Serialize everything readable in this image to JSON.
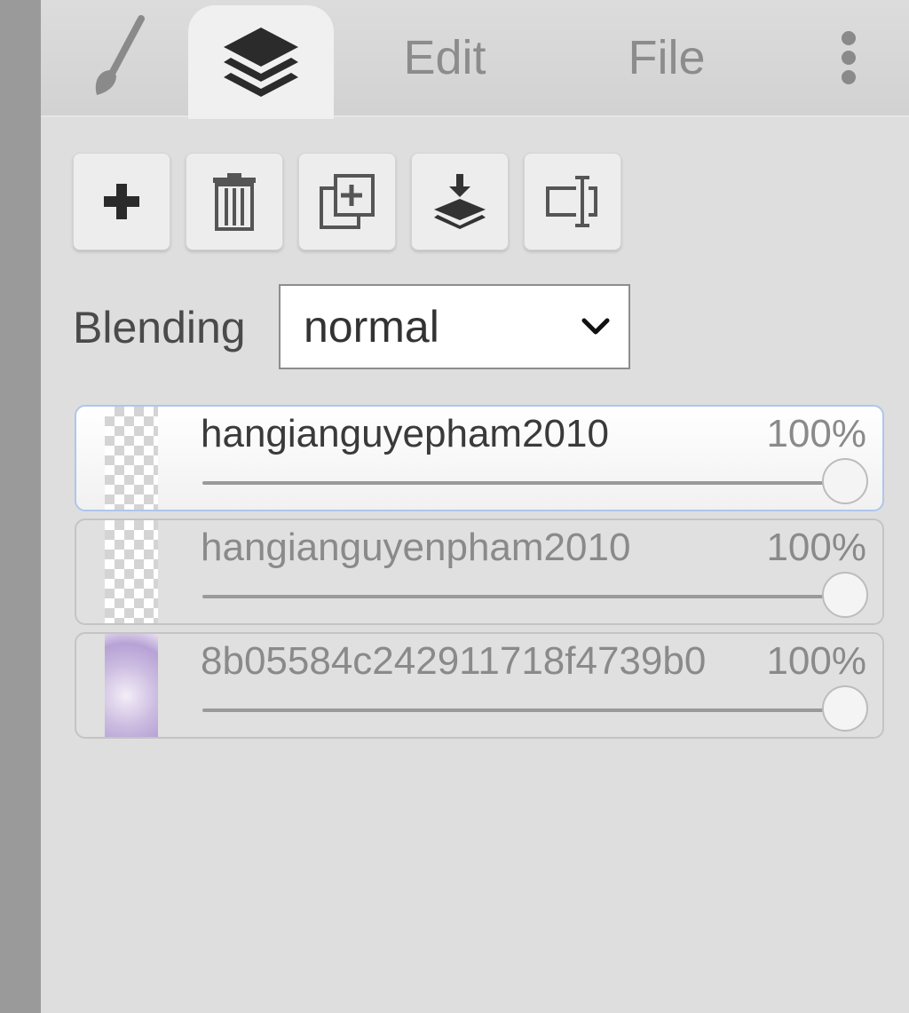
{
  "tabs": {
    "brush_icon": "brush-icon",
    "layers_icon": "layers-icon",
    "edit_label": "Edit",
    "file_label": "File",
    "more_icon": "more-vertical-icon"
  },
  "toolbar": {
    "buttons": [
      {
        "icon": "add-layer-icon"
      },
      {
        "icon": "trash-icon"
      },
      {
        "icon": "duplicate-layer-icon"
      },
      {
        "icon": "merge-down-icon"
      },
      {
        "icon": "rename-layer-icon"
      }
    ]
  },
  "blending": {
    "label": "Blending",
    "value": "normal"
  },
  "layers": [
    {
      "name": "hangianguyepham2010",
      "opacity": "100%",
      "opacity_value": 1.0,
      "active": true
    },
    {
      "name": "hangianguyenpham2010",
      "opacity": "100%",
      "opacity_value": 1.0,
      "active": false
    },
    {
      "name": "8b05584c242911718f4739b0",
      "opacity": "100%",
      "opacity_value": 1.0,
      "active": false
    }
  ],
  "colors": {
    "active_border": "#aec6ec",
    "panel_bg": "#dedede"
  }
}
